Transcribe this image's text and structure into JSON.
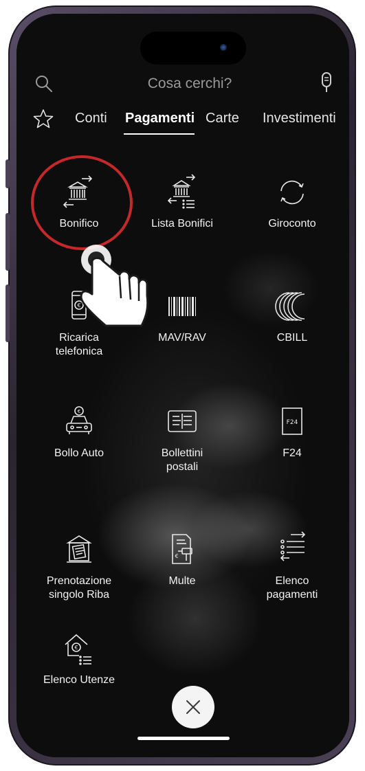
{
  "search": {
    "placeholder": "Cosa cerchi?"
  },
  "tabs": [
    {
      "label": "Conti"
    },
    {
      "label": "Pagamenti",
      "active": true
    },
    {
      "label": "Carte"
    },
    {
      "label": "Investimenti"
    }
  ],
  "tiles": [
    {
      "label": "Bonifico",
      "icon": "bank-transfer-icon",
      "highlighted": true
    },
    {
      "label": "Lista Bonifici",
      "icon": "bank-transfer-list-icon"
    },
    {
      "label": "Giroconto",
      "icon": "circular-arrows-icon"
    },
    {
      "label": "Ricarica\ntelefonica",
      "icon": "phone-topup-icon"
    },
    {
      "label": "MAV/RAV",
      "icon": "barcode-icon"
    },
    {
      "label": "CBILL",
      "icon": "cbill-icon"
    },
    {
      "label": "Bollo Auto",
      "icon": "car-tax-icon"
    },
    {
      "label": "Bollettini\npostali",
      "icon": "postal-slip-icon"
    },
    {
      "label": "F24",
      "icon": "f24-form-icon",
      "icon_text": "F24"
    },
    {
      "label": "Prenotazione\nsingolo Riba",
      "icon": "riba-booking-icon"
    },
    {
      "label": "Multe",
      "icon": "fine-document-icon"
    },
    {
      "label": "Elenco\npagamenti",
      "icon": "payments-list-icon"
    },
    {
      "label": "Elenco Utenze",
      "icon": "utilities-list-icon"
    }
  ],
  "colors": {
    "highlight_ring": "#c5282b",
    "background": "#0b0b0b",
    "text": "#f2f2f2"
  },
  "icons": {
    "search": "search-icon",
    "mic": "microphone-icon",
    "favorites": "star-icon",
    "close": "close-icon",
    "pointer": "hand-pointer-icon"
  }
}
